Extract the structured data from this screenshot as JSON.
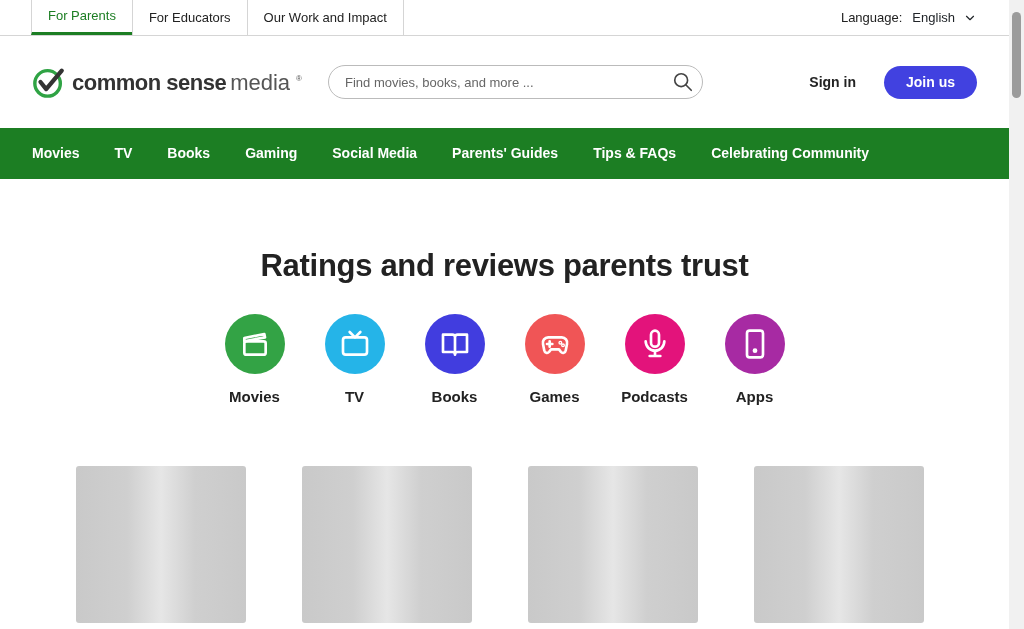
{
  "top_tabs": [
    {
      "label": "For Parents",
      "selected": true
    },
    {
      "label": "For Educators",
      "selected": false
    },
    {
      "label": "Our Work and Impact",
      "selected": false
    }
  ],
  "language": {
    "label": "Language:",
    "value": "English"
  },
  "logo": {
    "bold": "common sense",
    "light": "media",
    "mark": "®"
  },
  "search": {
    "placeholder": "Find movies, books, and more ..."
  },
  "sign_in": "Sign in",
  "join": "Join us",
  "nav": [
    "Movies",
    "TV",
    "Books",
    "Gaming",
    "Social Media",
    "Parents' Guides",
    "Tips & FAQs",
    "Celebrating Community"
  ],
  "heading": "Ratings and reviews parents trust",
  "categories": [
    {
      "label": "Movies",
      "color": "#33a345"
    },
    {
      "label": "TV",
      "color": "#25b4e8"
    },
    {
      "label": "Books",
      "color": "#413ddf"
    },
    {
      "label": "Games",
      "color": "#f05556"
    },
    {
      "label": "Podcasts",
      "color": "#e3137b"
    },
    {
      "label": "Apps",
      "color": "#a72aa3"
    }
  ],
  "cards": [
    {
      "kind": "placeholder"
    },
    {
      "kind": "placeholder"
    },
    {
      "kind": "placeholder"
    },
    {
      "kind": "placeholder"
    }
  ]
}
